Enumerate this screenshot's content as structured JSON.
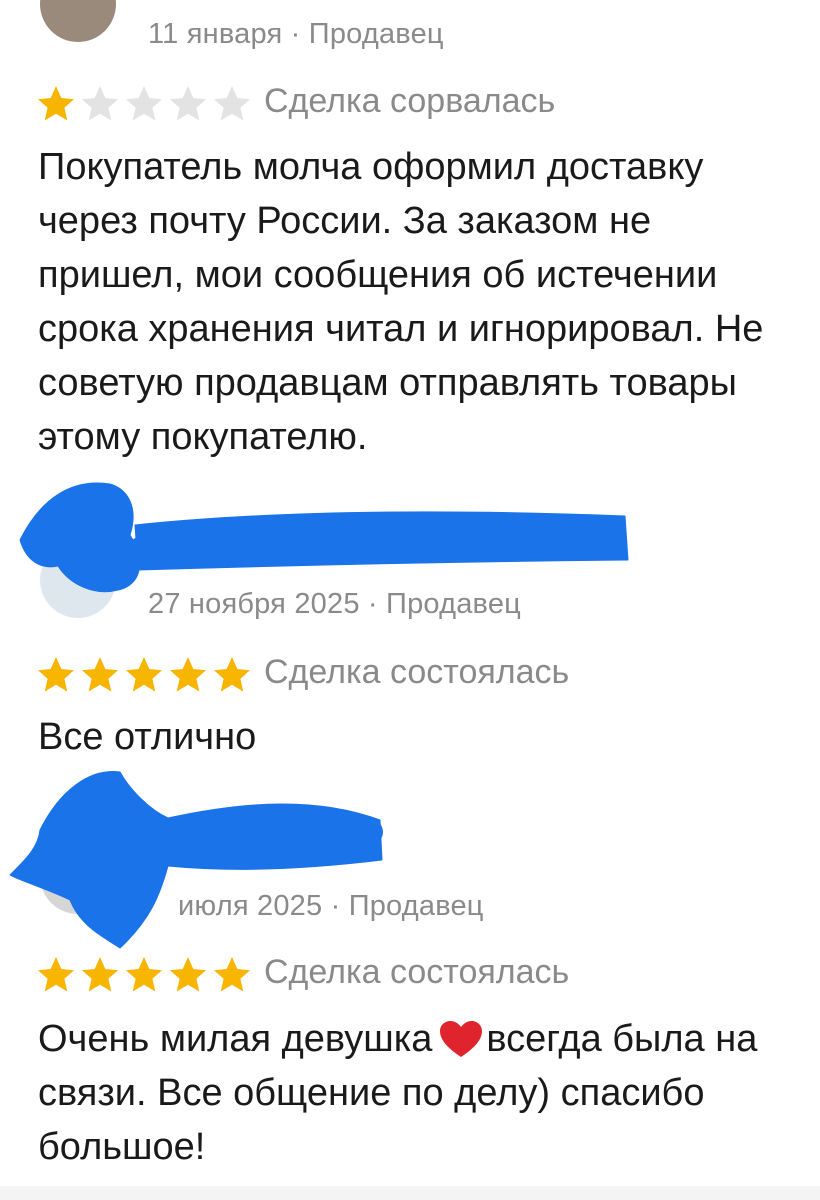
{
  "colors": {
    "star_filled": "#f7b500",
    "star_empty": "#e3e3e3",
    "meta_text": "#8a8a8a",
    "redaction": "#1a73e8",
    "heart": "#e0242e"
  },
  "reviews": [
    {
      "date": "11 января",
      "role": "Продавец",
      "rating": 1,
      "status": "Сделка сорвалась",
      "text": "Покупатель молча оформил доставку через почту России. За заказом не пришел, мои сообщения об истечении срока хранения читал и  игнорировал. Не советую продавцам отправлять товары этому покупателю."
    },
    {
      "date": "27 ноября 2025",
      "role": "Продавец",
      "rating": 5,
      "status": "Сделка состоялась",
      "text": "Все отлично"
    },
    {
      "date": "июля 2025",
      "role": "Продавец",
      "rating": 5,
      "status": "Сделка состоялась",
      "text_before_heart": "Очень милая девушка",
      "heart_icon": "red-heart-icon",
      "text_after_heart": "всегда была на связи. Все общение по делу) спасибо большое!"
    }
  ],
  "separator": " · "
}
